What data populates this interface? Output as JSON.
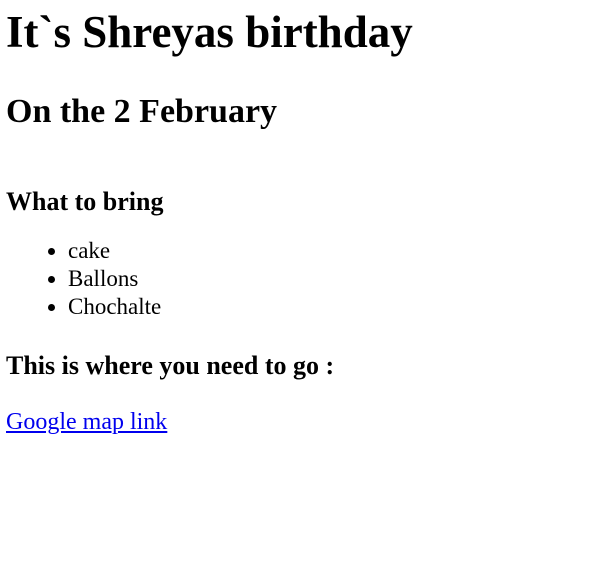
{
  "page": {
    "title": "It`s Shreyas birthday",
    "date_heading": "On the 2 February",
    "bring_heading": "What to bring",
    "bring_items": [
      "cake",
      "Ballons",
      "Chochalte"
    ],
    "where_heading": "This is where you need to go :",
    "map_link_text": "Google map link"
  },
  "colors": {
    "text": "#000000",
    "link": "#0000ee",
    "background": "#ffffff"
  }
}
